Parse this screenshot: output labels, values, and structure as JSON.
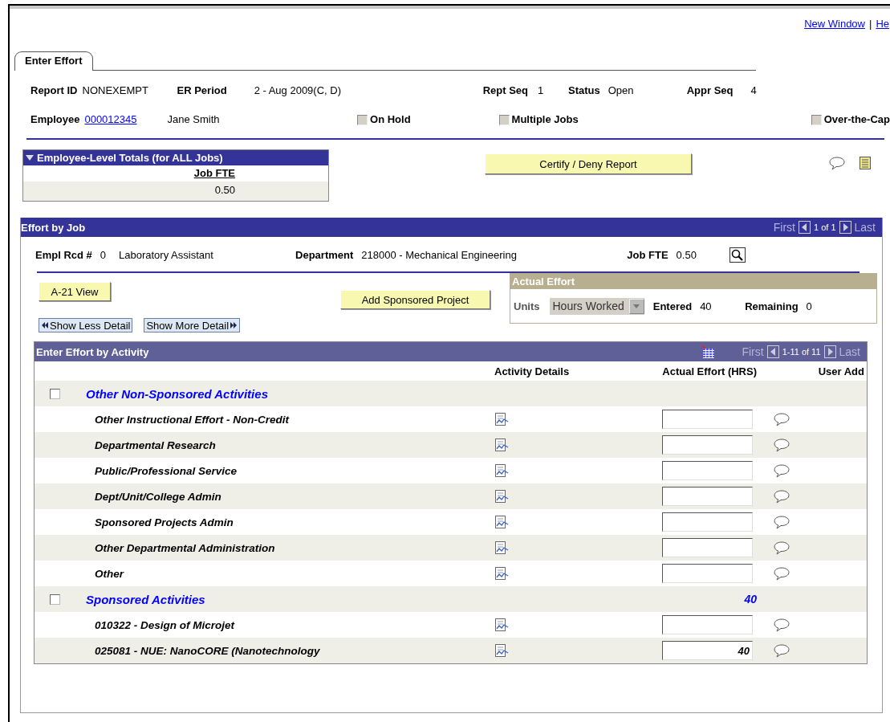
{
  "header_links": [
    {
      "label": "New Window"
    },
    {
      "label": "He"
    }
  ],
  "header_link_separator": "|",
  "tabs": [
    {
      "label": "Enter Effort",
      "selected": true
    }
  ],
  "report": {
    "report_id": {
      "label": "Report ID",
      "value": "NONEXEMPT"
    },
    "er_period": {
      "label": "ER Period",
      "value": "2 - Aug 2009(C, D)"
    },
    "rept_seq": {
      "label": "Rept Seq",
      "value": "1"
    },
    "status": {
      "label": "Status",
      "value": "Open"
    },
    "appr_seq": {
      "label": "Appr Seq",
      "value": "4"
    },
    "employee": {
      "label": "Employee",
      "id": "000012345",
      "name": "Jane Smith"
    },
    "flags": [
      {
        "label": "On Hold",
        "checked": false
      },
      {
        "label": "Multiple Jobs",
        "checked": false
      },
      {
        "label": "Over-the-Cap",
        "checked": false
      }
    ]
  },
  "totals": {
    "title": "Employee-Level Totals (for ALL Jobs)",
    "expanded": true,
    "column": "Job FTE",
    "value": "0.50"
  },
  "certify_button": "Certify / Deny Report",
  "effort_by_job": {
    "title": "Effort by Job",
    "nav": {
      "first": "First",
      "count": "1 of 1",
      "last": "Last"
    },
    "empl_rcd": {
      "label": "Empl Rcd #",
      "value": "0",
      "job": "Laboratory Assistant"
    },
    "department": {
      "label": "Department",
      "value": "218000 - Mechanical Engineering"
    },
    "job_fte": {
      "label": "Job FTE",
      "value": "0.50"
    },
    "buttons": {
      "a21": "A-21 View",
      "add": "Add Sponsored Project",
      "less": "Show Less Detail",
      "more": "Show More Detail"
    },
    "actual_effort": {
      "title": "Actual Effort",
      "units_label": "Units",
      "units_value": "Hours Worked",
      "entered_label": "Entered",
      "entered": "40",
      "remaining_label": "Remaining",
      "remaining": "0"
    },
    "activity_grid": {
      "title": "Enter Effort by Activity",
      "nav": {
        "first": "First",
        "count": "1-11 of 11",
        "last": "Last"
      },
      "columns": [
        "Activity Details",
        "Actual Effort (HRS)",
        "User Add"
      ],
      "rows": [
        {
          "kind": "group",
          "label": "Other Non-Sponsored Activities",
          "checked": false
        },
        {
          "kind": "activity",
          "label": "Other Instructional Effort - Non-Credit"
        },
        {
          "kind": "activity",
          "label": "Departmental Research"
        },
        {
          "kind": "activity",
          "label": "Public/Professional Service"
        },
        {
          "kind": "activity",
          "label": "Dept/Unit/College Admin"
        },
        {
          "kind": "activity",
          "label": "Sponsored Projects Admin"
        },
        {
          "kind": "activity",
          "label": "Other Departmental Administration"
        },
        {
          "kind": "activity",
          "label": "Other"
        },
        {
          "kind": "group",
          "label": "Sponsored Activities",
          "checked": false,
          "total": "40"
        },
        {
          "kind": "activity",
          "label": "010322 - Design of Microjet"
        },
        {
          "kind": "activity",
          "label": "025081 - NUE: NanoCORE (Nanotechnology",
          "value": "40"
        }
      ]
    }
  }
}
